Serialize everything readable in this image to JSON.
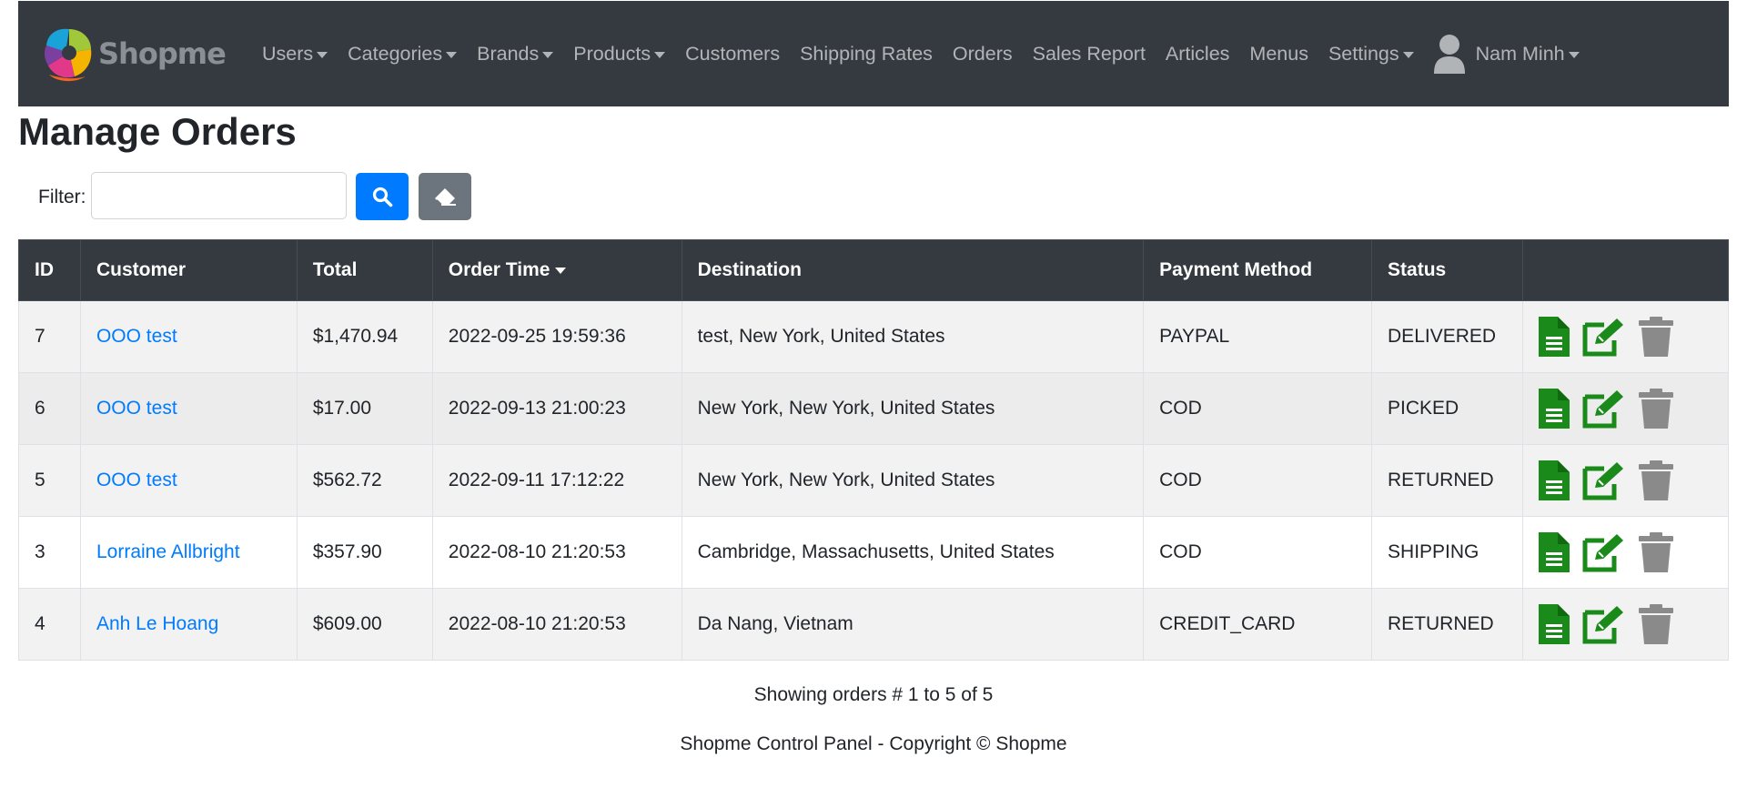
{
  "brand": {
    "name": "Shopme"
  },
  "nav": {
    "items": [
      {
        "label": "Users",
        "dropdown": true
      },
      {
        "label": "Categories",
        "dropdown": true
      },
      {
        "label": "Brands",
        "dropdown": true
      },
      {
        "label": "Products",
        "dropdown": true
      },
      {
        "label": "Customers",
        "dropdown": false
      },
      {
        "label": "Shipping Rates",
        "dropdown": false
      },
      {
        "label": "Orders",
        "dropdown": false
      },
      {
        "label": "Sales Report",
        "dropdown": false
      },
      {
        "label": "Articles",
        "dropdown": false
      },
      {
        "label": "Menus",
        "dropdown": false
      },
      {
        "label": "Settings",
        "dropdown": true
      }
    ],
    "user_name": "Nam Minh"
  },
  "page": {
    "title": "Manage Orders"
  },
  "filter": {
    "label": "Filter:",
    "value": "",
    "placeholder": ""
  },
  "table": {
    "headers": {
      "id": "ID",
      "customer": "Customer",
      "total": "Total",
      "order_time": "Order Time",
      "destination": "Destination",
      "payment_method": "Payment Method",
      "status": "Status"
    },
    "rows": [
      {
        "id": "7",
        "customer": "OOO test",
        "total": "$1,470.94",
        "order_time": "2022-09-25 19:59:36",
        "destination": "test, New York, United States",
        "payment_method": "PAYPAL",
        "status": "DELIVERED"
      },
      {
        "id": "6",
        "customer": "OOO test",
        "total": "$17.00",
        "order_time": "2022-09-13 21:00:23",
        "destination": "New York, New York, United States",
        "payment_method": "COD",
        "status": "PICKED"
      },
      {
        "id": "5",
        "customer": "OOO test",
        "total": "$562.72",
        "order_time": "2022-09-11 17:12:22",
        "destination": "New York, New York, United States",
        "payment_method": "COD",
        "status": "RETURNED"
      },
      {
        "id": "3",
        "customer": "Lorraine Allbright",
        "total": "$357.90",
        "order_time": "2022-08-10 21:20:53",
        "destination": "Cambridge, Massachusetts, United States",
        "payment_method": "COD",
        "status": "SHIPPING"
      },
      {
        "id": "4",
        "customer": "Anh Le Hoang",
        "total": "$609.00",
        "order_time": "2022-08-10 21:20:53",
        "destination": "Da Nang, Vietnam",
        "payment_method": "CREDIT_CARD",
        "status": "RETURNED"
      }
    ],
    "action_icons": [
      "file-alt-icon",
      "edit-icon",
      "trash-icon"
    ]
  },
  "footer": {
    "showing": "Showing orders # 1 to 5 of 5",
    "copyright": "Shopme Control Panel - Copyright © Shopme"
  },
  "colors": {
    "navbar": "#343a40",
    "primary": "#007bff",
    "secondary": "#6c757d",
    "action_green": "#1a8a1a",
    "trash_gray": "#8a8a8a"
  }
}
